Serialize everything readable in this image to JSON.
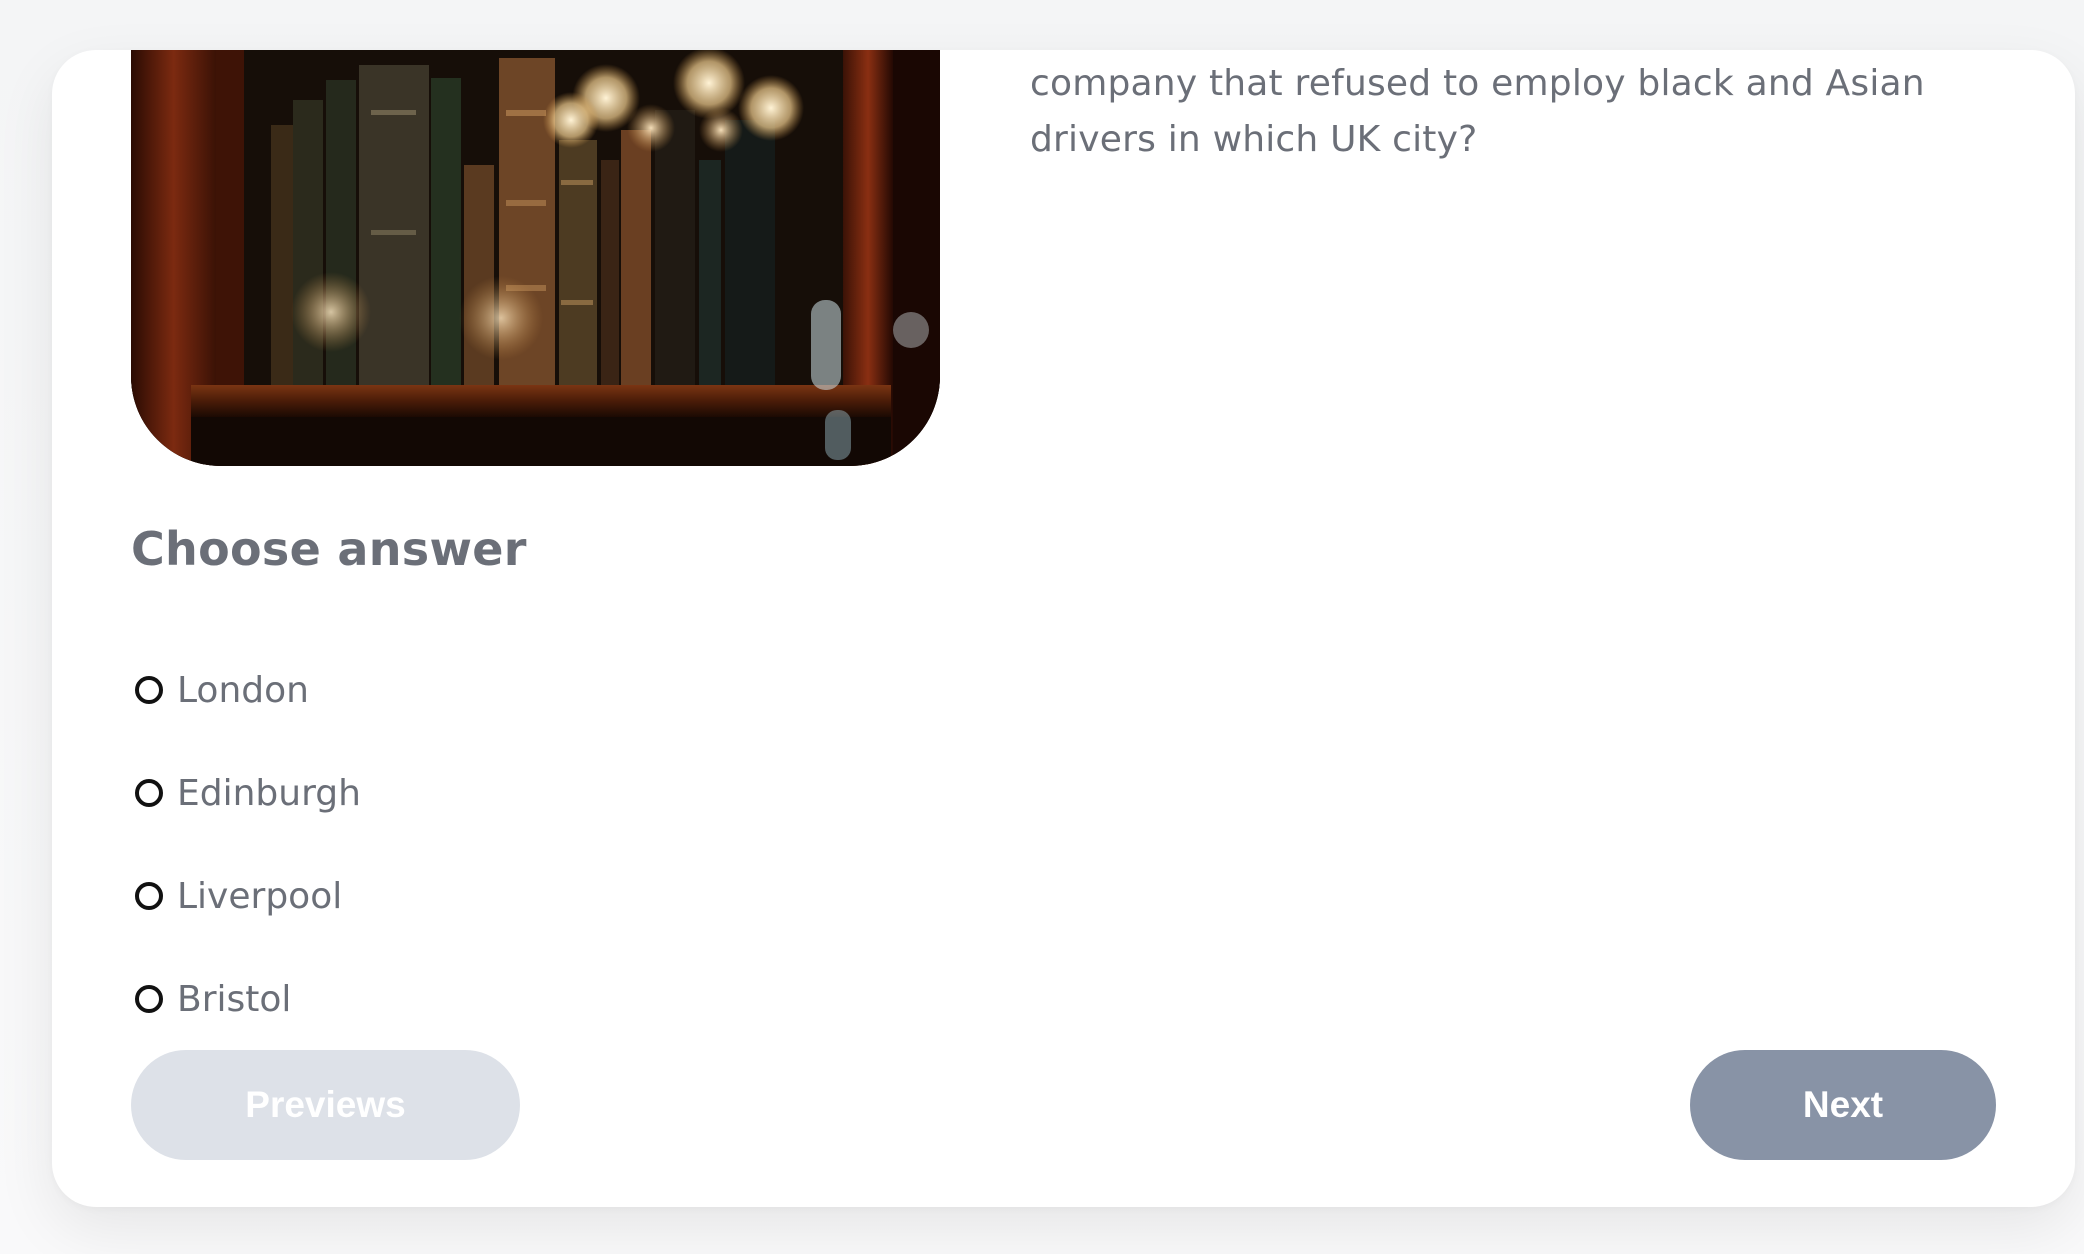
{
  "question": {
    "text": "company that refused to employ black and Asian drivers in which UK city?"
  },
  "image": {
    "subject": "books-on-shelf-photo"
  },
  "answers": {
    "title": "Choose answer",
    "options": [
      {
        "label": "London",
        "selected": false
      },
      {
        "label": "Edinburgh",
        "selected": false
      },
      {
        "label": "Liverpool",
        "selected": false
      },
      {
        "label": "Bristol",
        "selected": false
      }
    ]
  },
  "navigation": {
    "previous_label": "Previews",
    "next_label": "Next"
  },
  "colors": {
    "text_gray": "#6b6f78",
    "prev_button_bg": "#dde1e8",
    "next_button_bg": "#8893a6",
    "card_bg": "#ffffff"
  }
}
